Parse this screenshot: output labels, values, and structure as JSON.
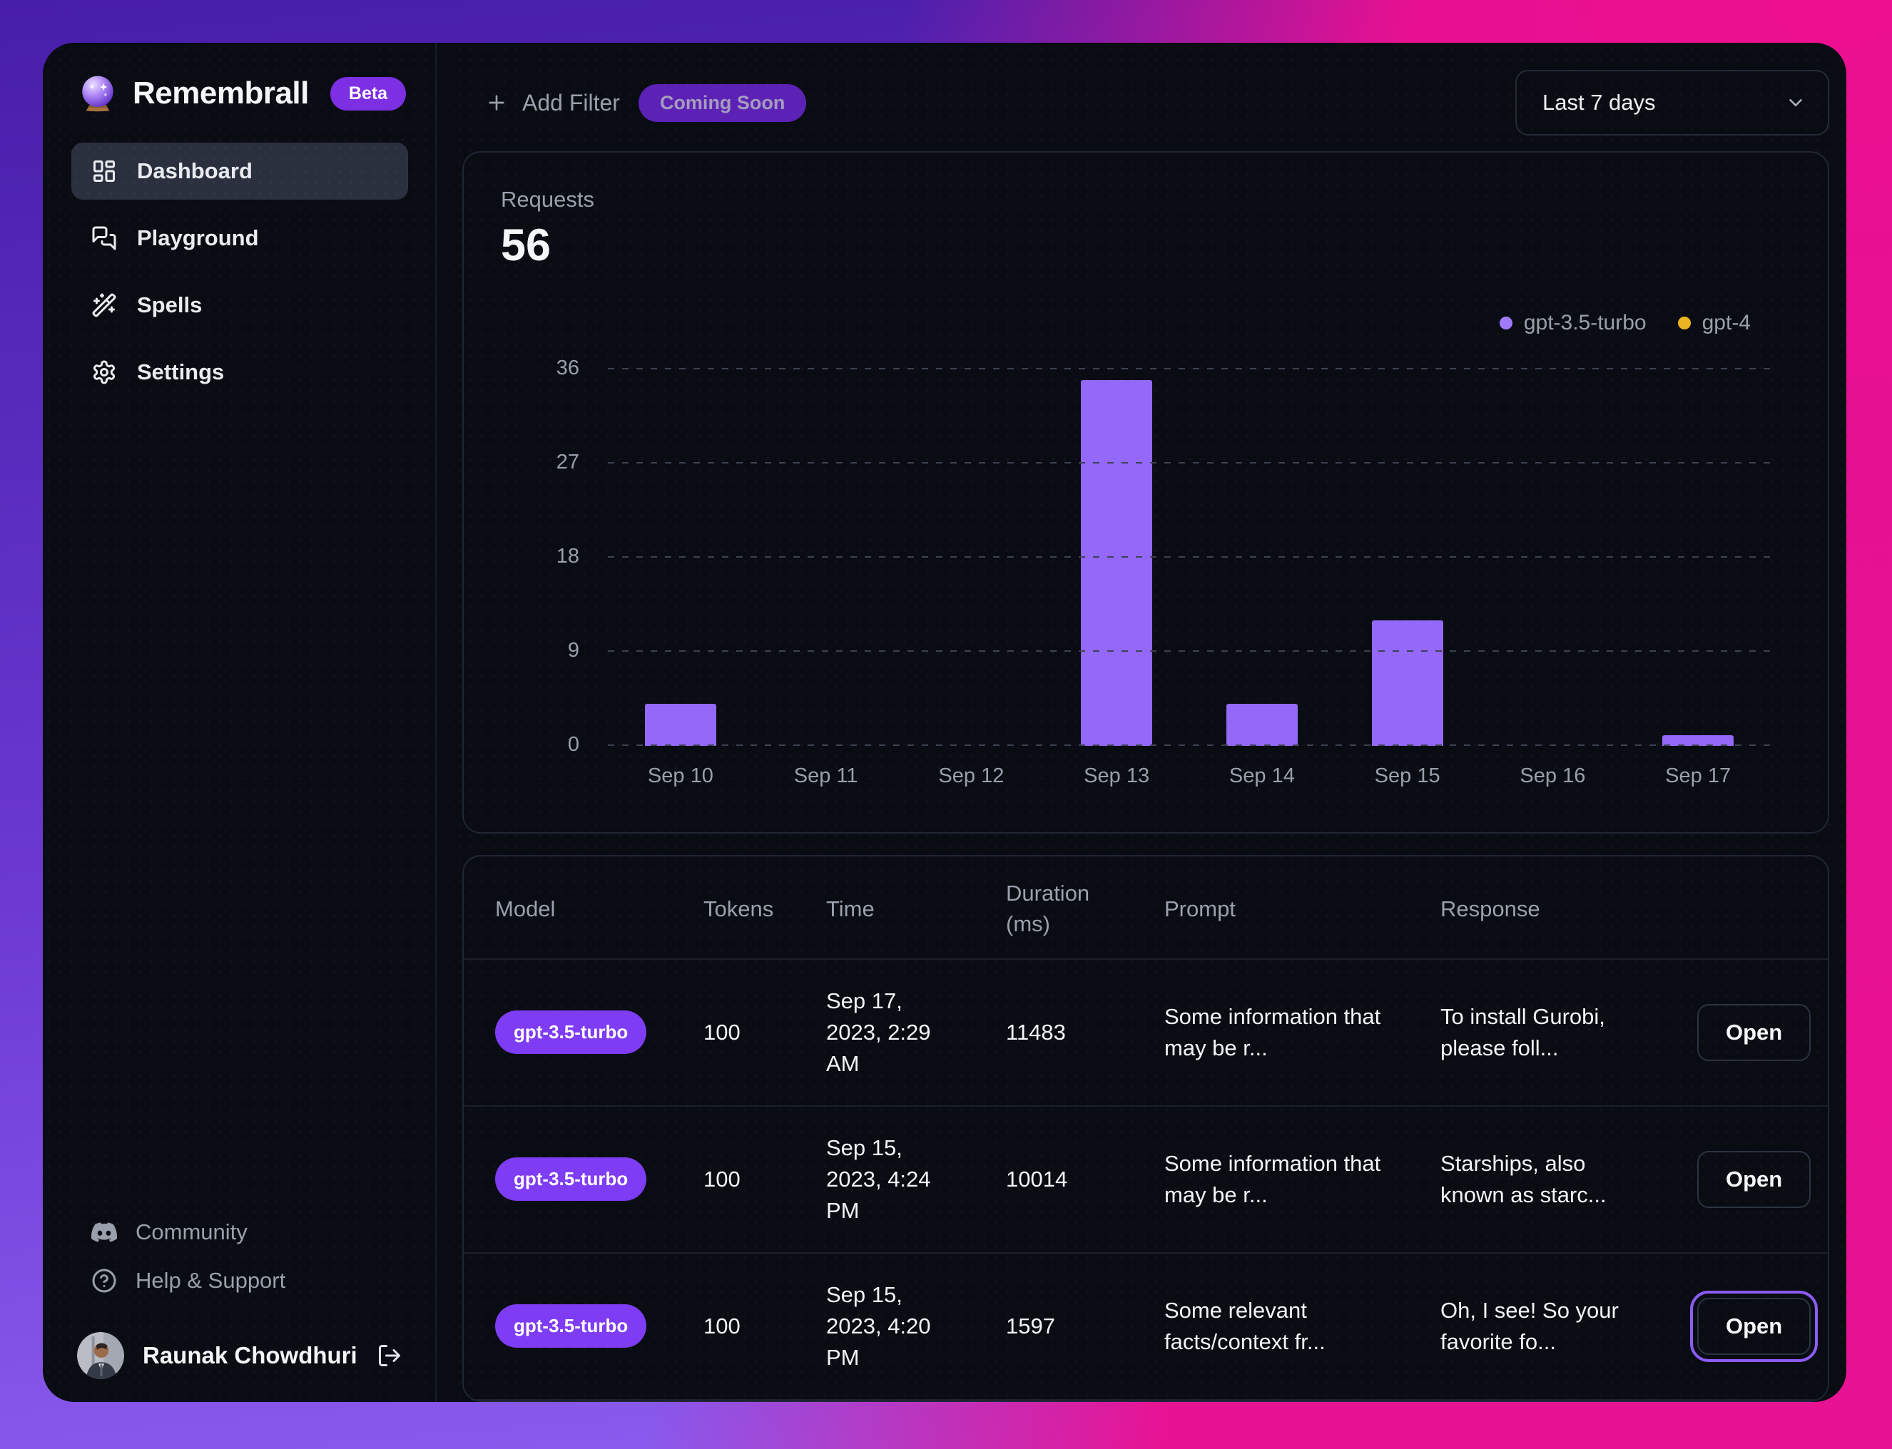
{
  "app": {
    "title": "Remembrall",
    "badge": "Beta"
  },
  "sidebar": {
    "nav": [
      {
        "icon": "dashboard-icon",
        "label": "Dashboard",
        "active": true
      },
      {
        "icon": "playground-icon",
        "label": "Playground",
        "active": false
      },
      {
        "icon": "spells-icon",
        "label": "Spells",
        "active": false
      },
      {
        "icon": "settings-icon",
        "label": "Settings",
        "active": false
      }
    ],
    "footer": [
      {
        "icon": "discord-icon",
        "label": "Community"
      },
      {
        "icon": "help-icon",
        "label": "Help & Support"
      }
    ],
    "user": {
      "name": "Raunak Chowdhuri"
    }
  },
  "topbar": {
    "add_filter_label": "Add Filter",
    "coming_soon_label": "Coming Soon",
    "date_range": "Last 7 days"
  },
  "stats": {
    "requests_label": "Requests",
    "requests_value": "56"
  },
  "chart_data": {
    "type": "bar",
    "title": "Requests",
    "categories": [
      "Sep 10",
      "Sep 11",
      "Sep 12",
      "Sep 13",
      "Sep 14",
      "Sep 15",
      "Sep 16",
      "Sep 17"
    ],
    "series": [
      {
        "name": "gpt-3.5-turbo",
        "color": "#9f7bfa",
        "values": [
          4,
          0,
          0,
          35,
          4,
          12,
          0,
          1
        ]
      },
      {
        "name": "gpt-4",
        "color": "#eab520",
        "values": [
          0,
          0,
          0,
          0,
          0,
          0,
          0,
          0
        ]
      }
    ],
    "ylim": [
      0,
      36
    ],
    "yticks": [
      0,
      9,
      18,
      27,
      36
    ],
    "grid": "horizontal-dashed",
    "legend_position": "top-right",
    "bar_color": "#9468f8"
  },
  "table": {
    "columns": [
      "Model",
      "Tokens",
      "Time",
      "Duration (ms)",
      "Prompt",
      "Response"
    ],
    "open_label": "Open",
    "rows": [
      {
        "model": "gpt-3.5-turbo",
        "tokens": "100",
        "time": "Sep 17, 2023, 2:29 AM",
        "duration": "11483",
        "prompt": "Some information that may be r...",
        "response": "To install Gurobi, please foll...",
        "focused": false
      },
      {
        "model": "gpt-3.5-turbo",
        "tokens": "100",
        "time": "Sep 15, 2023, 4:24 PM",
        "duration": "10014",
        "prompt": "Some information that may be r...",
        "response": "Starships, also known as starc...",
        "focused": false
      },
      {
        "model": "gpt-3.5-turbo",
        "tokens": "100",
        "time": "Sep 15, 2023, 4:20 PM",
        "duration": "1597",
        "prompt": "Some relevant facts/context fr...",
        "response": "Oh, I see! So your favorite fo...",
        "focused": true
      }
    ]
  },
  "colors": {
    "accent_purple": "#8b5cf6",
    "badge_purple": "#7e3cf4",
    "beta_purple": "#7c2fe3",
    "coming_soon_bg": "#5c22b5",
    "gpt4_yellow": "#eab520",
    "window_bg": "#0a0c13",
    "muted_text": "#99a0ac",
    "gradient_top_left": "#471ea9",
    "gradient_top_right": "#f20f95",
    "gradient_bottom_left": "#8f60f2",
    "gradient_bottom_right": "#ee4fa4"
  }
}
